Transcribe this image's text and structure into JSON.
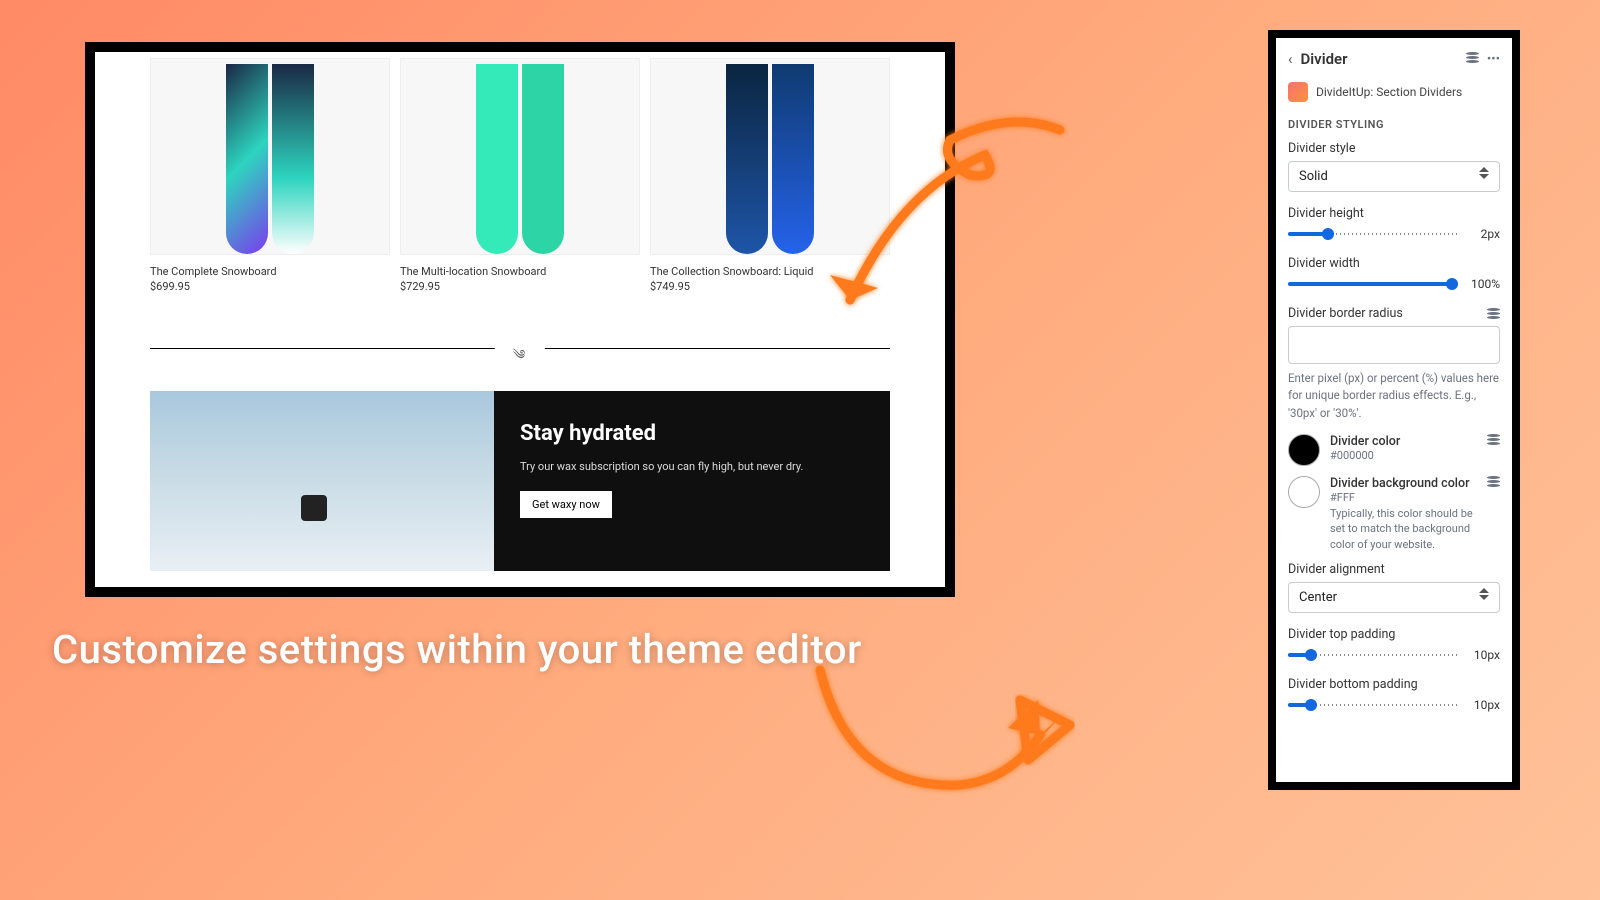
{
  "caption": "Customize settings within your theme editor",
  "products": [
    {
      "title": "The Complete Snowboard",
      "price": "$699.95"
    },
    {
      "title": "The Multi-location Snowboard",
      "price": "$729.95"
    },
    {
      "title": "The Collection Snowboard: Liquid",
      "price": "$749.95"
    }
  ],
  "promo": {
    "heading": "Stay hydrated",
    "body": "Try our wax subscription so you can fly high, but never dry.",
    "button": "Get waxy now"
  },
  "panel": {
    "title": "Divider",
    "app": "DivideItUp: Section Dividers",
    "section_label": "DIVIDER STYLING",
    "fields": {
      "style_label": "Divider style",
      "style_value": "Solid",
      "height_label": "Divider height",
      "height_value": "2px",
      "width_label": "Divider width",
      "width_value": "100%",
      "radius_label": "Divider border radius",
      "radius_value": "",
      "radius_help": "Enter pixel (px) or percent (%) values here for unique border radius effects. E.g., '30px' or '30%'.",
      "color_label": "Divider color",
      "color_hex": "#000000",
      "bg_label": "Divider background color",
      "bg_hex": "#FFF",
      "bg_help": "Typically, this color should be set to match the background color of your website.",
      "align_label": "Divider alignment",
      "align_value": "Center",
      "top_pad_label": "Divider top padding",
      "top_pad_value": "10px",
      "bottom_pad_label": "Divider bottom padding",
      "bottom_pad_value": "10px"
    }
  }
}
